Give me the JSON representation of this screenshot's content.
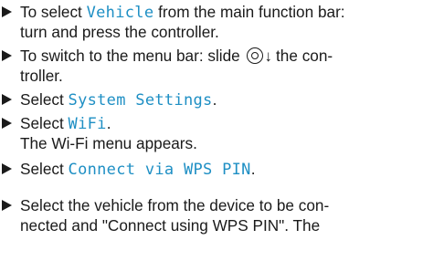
{
  "steps": [
    {
      "lines": [
        [
          "To select ",
          "Vehicle",
          " from the main function bar:"
        ],
        [
          "turn and press the controller."
        ]
      ]
    },
    {
      "lines": [
        [
          "To switch to the menu bar: slide ",
          "the con-"
        ],
        [
          "troller."
        ]
      ],
      "icon": "controller-slide-down-icon",
      "arrow": "↓"
    },
    {
      "lines": [
        [
          "Select ",
          "System Settings",
          "."
        ]
      ]
    },
    {
      "lines": [
        [
          "Select ",
          "WiFi",
          "."
        ],
        [
          "The Wi-Fi menu appears."
        ]
      ]
    },
    {
      "lines": [
        [
          "Select ",
          "Connect via WPS PIN",
          "."
        ]
      ]
    },
    {
      "lines": [
        [
          "Select the vehicle from the device to be con-"
        ],
        [
          "nected and \"Connect using WPS PIN\". The"
        ]
      ]
    }
  ],
  "colors": {
    "text": "#1a1a1a",
    "menu_item": "#1e8fc4"
  }
}
